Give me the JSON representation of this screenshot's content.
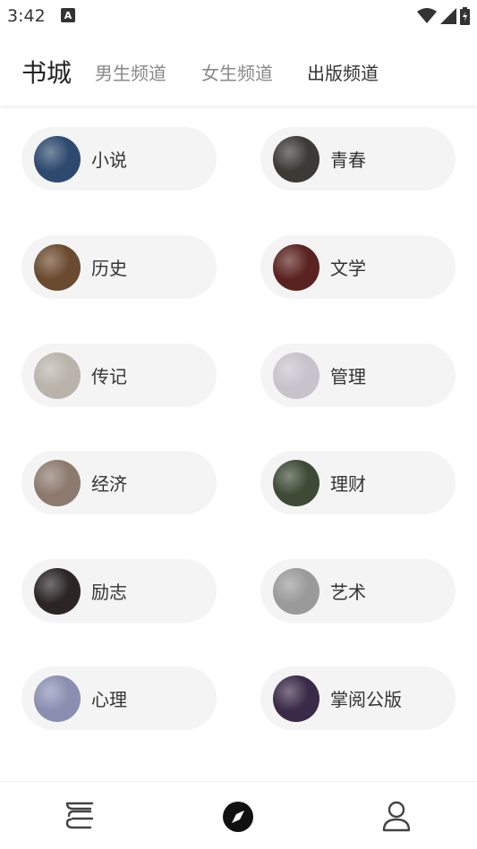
{
  "status": {
    "time": "3:42",
    "notification_glyph": "A"
  },
  "header": {
    "title": "书城",
    "tabs": [
      {
        "label": "男生频道"
      },
      {
        "label": "女生频道"
      },
      {
        "label": "出版频道"
      }
    ]
  },
  "categories": [
    {
      "label": "小说",
      "cover_color": "#2d4a6e"
    },
    {
      "label": "青春",
      "cover_color": "#3d3a36"
    },
    {
      "label": "历史",
      "cover_color": "#6b4b30"
    },
    {
      "label": "文学",
      "cover_color": "#5a2320"
    },
    {
      "label": "传记",
      "cover_color": "#b9b3ab"
    },
    {
      "label": "管理",
      "cover_color": "#c7c2cc"
    },
    {
      "label": "经济",
      "cover_color": "#8c7a6e"
    },
    {
      "label": "理财",
      "cover_color": "#3e4a36"
    },
    {
      "label": "励志",
      "cover_color": "#2b2526"
    },
    {
      "label": "艺术",
      "cover_color": "#9a9a9a"
    },
    {
      "label": "心理",
      "cover_color": "#8a8fb2"
    },
    {
      "label": "掌阅公版",
      "cover_color": "#3a2a48"
    }
  ],
  "colors": {
    "accent": "#222222",
    "pill_bg": "#f4f4f4",
    "tab_inactive": "#888888"
  },
  "bottom_nav": [
    {
      "icon": "bookshelf-icon"
    },
    {
      "icon": "compass-icon"
    },
    {
      "icon": "profile-icon"
    }
  ]
}
